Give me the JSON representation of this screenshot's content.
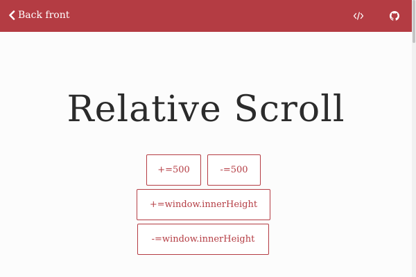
{
  "nav": {
    "back_label": "Back front",
    "icons": [
      "code-icon",
      "github-icon"
    ]
  },
  "page": {
    "title": "Relative Scroll"
  },
  "buttons": {
    "plus_500": "+=500",
    "minus_500": "-=500",
    "plus_inner_height": "+=window.innerHeight",
    "minus_inner_height": "-=window.innerHeight"
  },
  "colors": {
    "accent": "#b43c43",
    "background": "#fcfcfc",
    "title_text": "#2b2b2b"
  }
}
